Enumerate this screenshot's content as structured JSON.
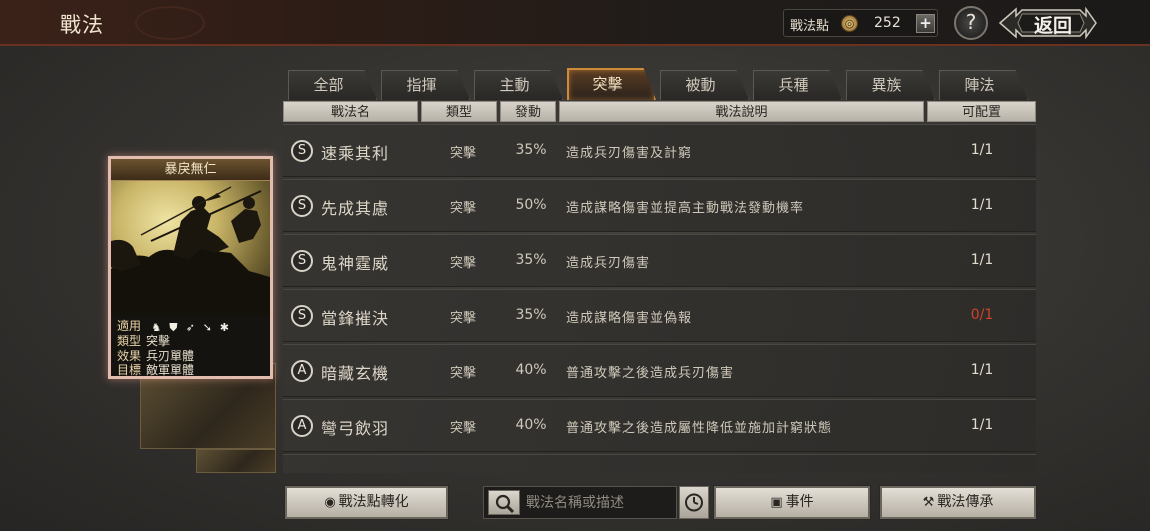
{
  "header": {
    "title": "戰法",
    "points_label": "戰法點",
    "points_icon": "coin-icon",
    "points_value": "252",
    "plus": "+",
    "help": "?",
    "back_label": "返回"
  },
  "tabs": [
    {
      "label": "全部",
      "active": false
    },
    {
      "label": "指揮",
      "active": false
    },
    {
      "label": "主動",
      "active": false
    },
    {
      "label": "突擊",
      "active": true
    },
    {
      "label": "被動",
      "active": false
    },
    {
      "label": "兵種",
      "active": false
    },
    {
      "label": "異族",
      "active": false
    },
    {
      "label": "陣法",
      "active": false
    }
  ],
  "columns": {
    "name": "戰法名",
    "type": "類型",
    "rate": "發動",
    "desc": "戰法說明",
    "count": "可配置"
  },
  "rows": [
    {
      "grade": "S",
      "name": "速乘其利",
      "type": "突擊",
      "rate": "35%",
      "desc": "造成兵刃傷害及計窮",
      "count": "1/1",
      "count_warning": false
    },
    {
      "grade": "S",
      "name": "先成其慮",
      "type": "突擊",
      "rate": "50%",
      "desc": "造成謀略傷害並提高主動戰法發動機率",
      "count": "1/1",
      "count_warning": false
    },
    {
      "grade": "S",
      "name": "鬼神霆威",
      "type": "突擊",
      "rate": "35%",
      "desc": "造成兵刃傷害",
      "count": "1/1",
      "count_warning": false
    },
    {
      "grade": "S",
      "name": "當鋒摧決",
      "type": "突擊",
      "rate": "35%",
      "desc": "造成謀略傷害並偽報",
      "count": "0/1",
      "count_warning": true
    },
    {
      "grade": "A",
      "name": "暗藏玄機",
      "type": "突擊",
      "rate": "40%",
      "desc": "普通攻擊之後造成兵刃傷害",
      "count": "1/1",
      "count_warning": false
    },
    {
      "grade": "A",
      "name": "彎弓飲羽",
      "type": "突擊",
      "rate": "40%",
      "desc": "普通攻擊之後造成屬性降低並施加計窮狀態",
      "count": "1/1",
      "count_warning": false
    }
  ],
  "card": {
    "title": "暴戾無仁",
    "applies_label": "適用",
    "applies_icons": [
      "cavalry-icon",
      "shield-icon",
      "bow-icon",
      "spear-icon",
      "wheel-icon"
    ],
    "type_label": "類型",
    "type_value": "突擊",
    "effect_label": "效果",
    "effect_value": "兵刃單體",
    "target_label": "目標",
    "target_value": "敵軍單體"
  },
  "bottom": {
    "convert_label": "戰法點轉化",
    "search_placeholder": "戰法名稱或描述",
    "event_label": "事件",
    "inherit_label": "戰法傳承"
  },
  "colors": {
    "active_tab_border": "#d08b38",
    "warning_count": "#d2412c",
    "card_border": "#e2bcae"
  }
}
